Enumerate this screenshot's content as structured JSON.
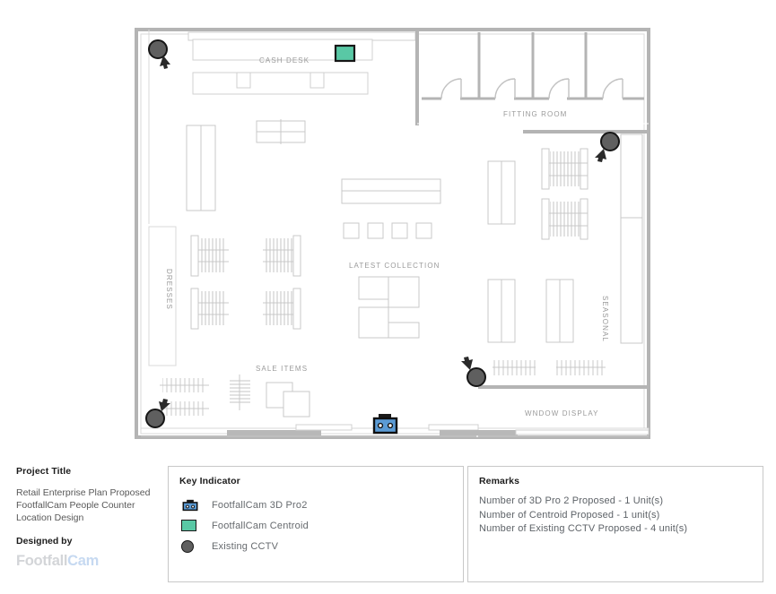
{
  "project": {
    "heading": "Project Title",
    "description": "Retail Enterprise Plan Proposed FootfallCam People Counter Location Design",
    "designed_by_heading": "Designed by",
    "logo_part1": "Footfall",
    "logo_part2": "Cam"
  },
  "key_indicator": {
    "heading": "Key Indicator",
    "items": [
      {
        "icon": "footfallcam-3d-pro2-icon",
        "label": "FootfallCam 3D Pro2",
        "color": "#5b9bd5"
      },
      {
        "icon": "footfallcam-centroid-icon",
        "label": "FootfallCam Centroid",
        "color": "#59c8a5"
      },
      {
        "icon": "existing-cctv-icon",
        "label": "Existing CCTV",
        "color": "#5f5f5f"
      }
    ]
  },
  "remarks": {
    "heading": "Remarks",
    "lines": [
      "Number of 3D Pro 2 Proposed - 1 Unit(s)",
      "Number of Centroid Proposed - 1 unit(s)",
      "Number of Existing CCTV Proposed - 4 unit(s)"
    ]
  },
  "floorplan": {
    "zone_labels": {
      "cash_desk": "CASH DESK",
      "fitting_room": "FITTING ROOM",
      "dresses": "DRESSES",
      "latest_collection": "LATEST COLLECTION",
      "seasonal": "SEASONAL",
      "sale_items": "SALE ITEMS",
      "window_display": "WNDOW DISPLAY"
    },
    "devices": {
      "cctv_count": 4,
      "centroid_count": 1,
      "pro2_count": 1
    },
    "colors": {
      "wall": "#b4b4b4",
      "fixture": "#c9c9c9",
      "label_text": "#9a9a9a",
      "cctv": "#5f5f5f",
      "centroid": "#59c8a5",
      "pro2": "#5b9bd5"
    }
  }
}
